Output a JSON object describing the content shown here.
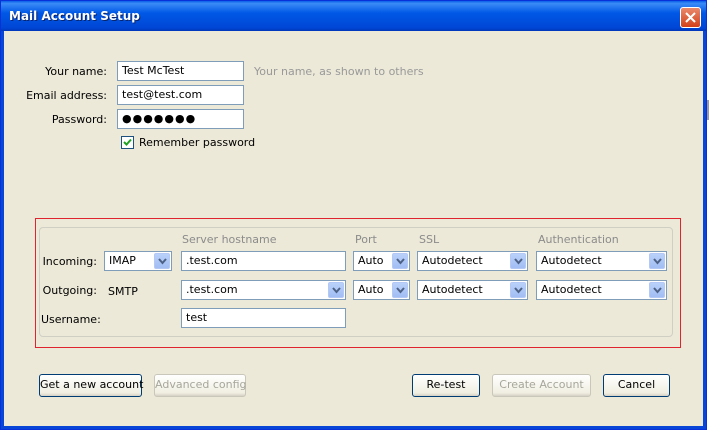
{
  "window": {
    "title": "Mail Account Setup"
  },
  "form": {
    "name_label": "Your name:",
    "name_value": "Test McTest",
    "name_hint": "Your name, as shown to others",
    "email_label": "Email address:",
    "email_value": "test@test.com",
    "password_label": "Password:",
    "password_value": "●●●●●●●",
    "remember_label": "Remember password",
    "remember_checked": true
  },
  "server": {
    "col_hostname": "Server hostname",
    "col_port": "Port",
    "col_ssl": "SSL",
    "col_auth": "Authentication",
    "incoming_label": "Incoming:",
    "incoming_protocol": "IMAP",
    "incoming_hostname": ".test.com",
    "incoming_port": "Auto",
    "incoming_ssl": "Autodetect",
    "incoming_auth": "Autodetect",
    "outgoing_label": "Outgoing:",
    "outgoing_protocol": "SMTP",
    "outgoing_hostname": ".test.com",
    "outgoing_port": "Auto",
    "outgoing_ssl": "Autodetect",
    "outgoing_auth": "Autodetect",
    "username_label": "Username:",
    "username_value": "test"
  },
  "buttons": {
    "new_account": "Get a new account",
    "advanced": "Advanced config",
    "retest": "Re-test",
    "create": "Create Account",
    "cancel": "Cancel"
  },
  "icons": {
    "close": "close-icon",
    "check": "checkmark-icon",
    "dropdown": "chevron-down-icon"
  },
  "colors": {
    "titlebar": "#0054e3",
    "highlight_border": "#e0242f",
    "window_bg": "#ece9d8"
  }
}
